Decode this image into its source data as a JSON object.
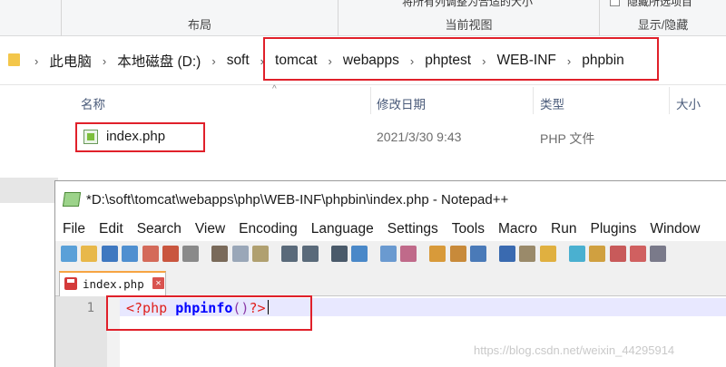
{
  "ribbon": {
    "groups": [
      "布局",
      "当前视图",
      "显示/隐藏"
    ],
    "cut_text_left": "将所有列调整为合适的大小",
    "cut_text_right": "隐藏所选项目"
  },
  "address_bar": {
    "crumbs": [
      "此电脑",
      "本地磁盘 (D:)",
      "soft",
      "tomcat",
      "webapps",
      "phptest",
      "WEB-INF",
      "phpbin"
    ]
  },
  "file_list": {
    "columns": [
      "名称",
      "修改日期",
      "类型",
      "大小"
    ],
    "rows": [
      {
        "name": "index.php",
        "date": "2021/3/30 9:43",
        "type": "PHP 文件"
      }
    ]
  },
  "notepad": {
    "title": "*D:\\soft\\tomcat\\webapps\\php\\WEB-INF\\phpbin\\index.php - Notepad++",
    "menu": [
      "File",
      "Edit",
      "Search",
      "View",
      "Encoding",
      "Language",
      "Settings",
      "Tools",
      "Macro",
      "Run",
      "Plugins",
      "Window"
    ],
    "tab_label": "index.php",
    "line_numbers": [
      "1"
    ],
    "code": {
      "open_tag": "<?php",
      "function": "phpinfo",
      "parens": "()",
      "close_tag": "?>"
    },
    "toolbar_icons": [
      "new-icon",
      "open-icon",
      "save-icon",
      "save-all-icon",
      "close-icon",
      "close-all-icon",
      "print-icon",
      "cut-icon",
      "copy-icon",
      "paste-icon",
      "undo-icon",
      "redo-icon",
      "find-icon",
      "replace-icon",
      "zoom-in-icon",
      "zoom-out-icon",
      "sync-v-icon",
      "sync-h-icon",
      "wrap-icon",
      "show-all-chars-icon",
      "indent-guide-icon",
      "doc-map-icon",
      "function-list-icon",
      "folder-workspace-icon",
      "monitor-icon",
      "record-macro-icon",
      "view-icon"
    ]
  },
  "watermark": "https://blog.csdn.net/weixin_44295914",
  "colors": {
    "highlight_box": "#e0202a",
    "php_tag": "#e0201c",
    "php_function": "#0000ff"
  }
}
